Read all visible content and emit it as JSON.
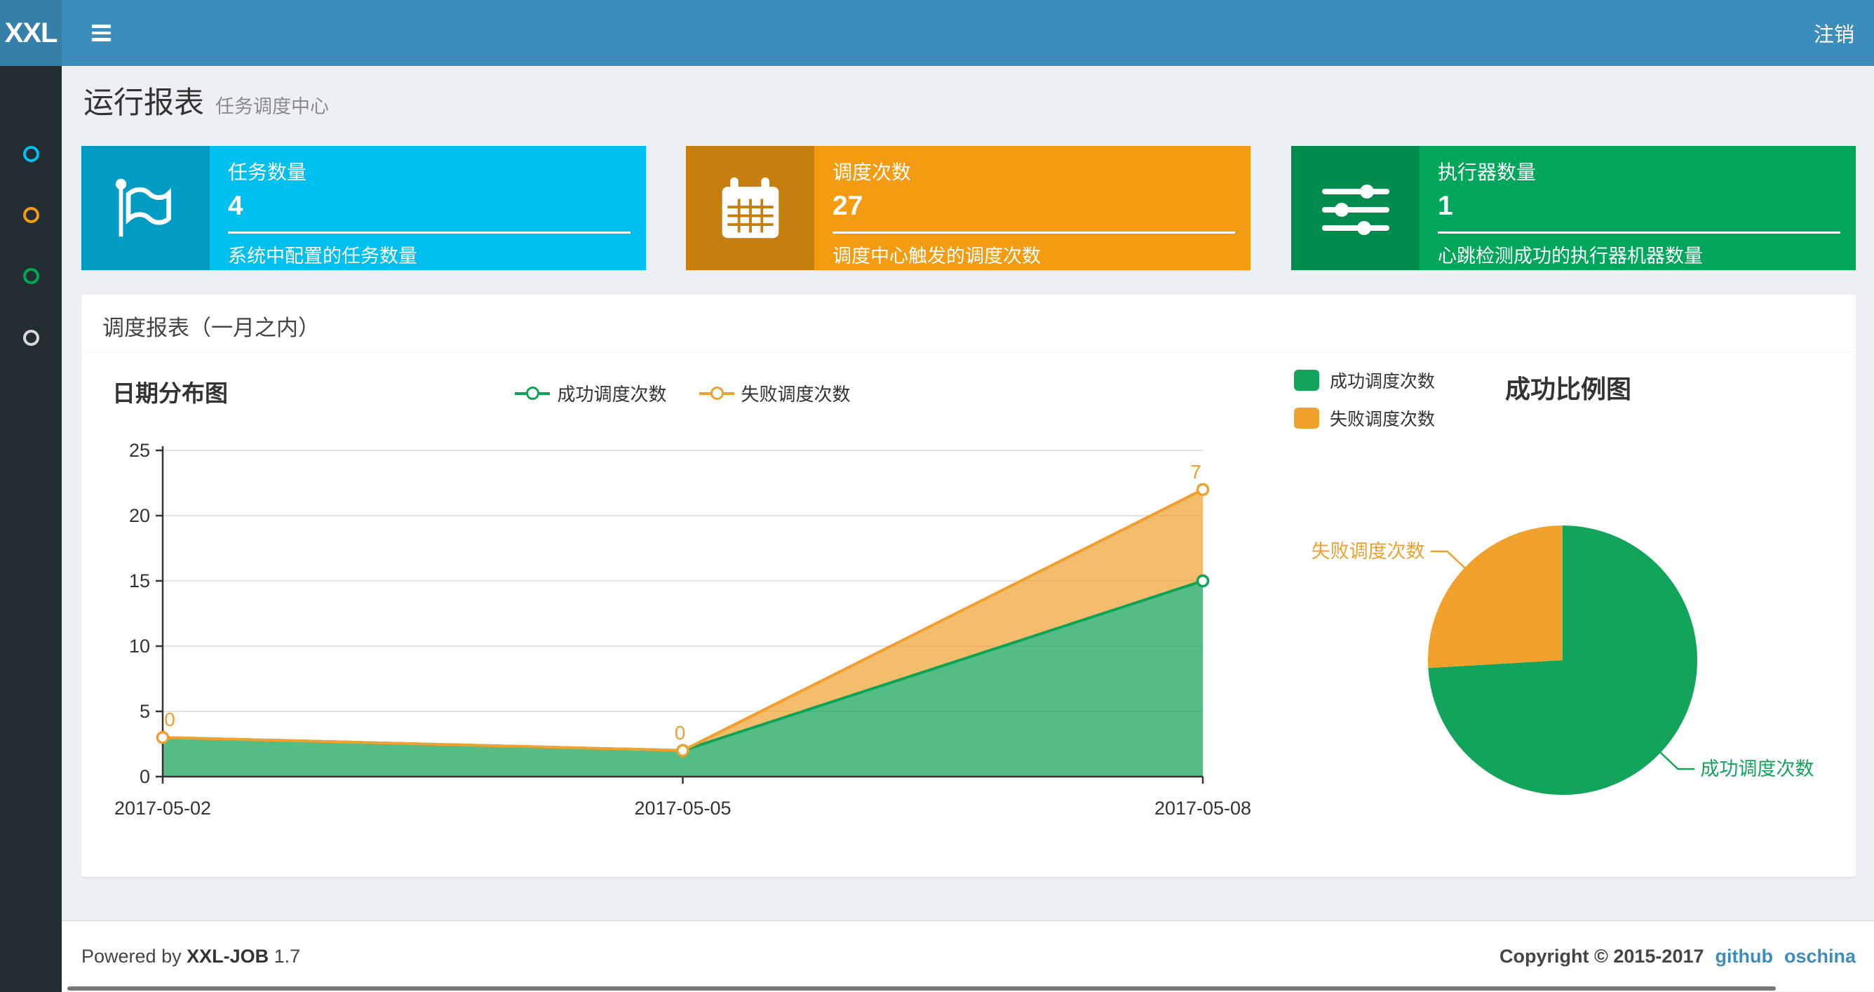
{
  "navbar": {
    "logo": "XXL",
    "logout_label": "注销",
    "bg_color": "#3c8dbc",
    "logo_bg_color": "#367fa9"
  },
  "sidebar": {
    "bg_color": "#222d32",
    "items": [
      {
        "icon": "circle-icon",
        "color": "#00c0ef"
      },
      {
        "icon": "circle-icon",
        "color": "#f39c12"
      },
      {
        "icon": "circle-icon",
        "color": "#00a65a"
      },
      {
        "icon": "circle-icon",
        "color": "#d8d8d8"
      }
    ]
  },
  "header": {
    "title": "运行报表",
    "subtitle": "任务调度中心"
  },
  "info_boxes": [
    {
      "label": "任务数量",
      "value": "4",
      "desc": "系统中配置的任务数量",
      "icon": "flag-icon",
      "color": "#00c0ef",
      "icon_bg": "#009cc3"
    },
    {
      "label": "调度次数",
      "value": "27",
      "desc": "调度中心触发的调度次数",
      "icon": "calendar-icon",
      "color": "#f39c12",
      "icon_bg": "#c67f0e"
    },
    {
      "label": "执行器数量",
      "value": "1",
      "desc": "心跳检测成功的执行器机器数量",
      "icon": "sliders-icon",
      "color": "#00a65a",
      "icon_bg": "#008c4c"
    }
  ],
  "panel": {
    "title": "调度报表（一月之内）"
  },
  "chart_data": [
    {
      "type": "area",
      "title": "日期分布图",
      "stacked": true,
      "x": [
        "2017-05-02",
        "2017-05-05",
        "2017-05-08"
      ],
      "series": [
        {
          "name": "成功调度次数",
          "values": [
            3,
            2,
            15
          ],
          "color": "#0fa358",
          "fill": "rgba(18,163,88,0.72)",
          "labeled": false
        },
        {
          "name": "失败调度次数",
          "values": [
            0,
            0,
            7
          ],
          "color": "#efa02e",
          "fill": "rgba(240,161,46,0.70)",
          "labeled": true
        }
      ],
      "ylim": [
        0,
        25
      ],
      "yticks": [
        0,
        5,
        10,
        15,
        20,
        25
      ],
      "grid": true,
      "grid_color": "#e3e3e3",
      "axis_color": "#333333",
      "legend_position": "top"
    },
    {
      "type": "pie",
      "title": "成功比例图",
      "slices": [
        {
          "name": "成功调度次数",
          "value": 20,
          "color": "#13a45c"
        },
        {
          "name": "失败调度次数",
          "value": 7,
          "color": "#f0a12c"
        }
      ],
      "legend_position": "top-left",
      "start_angle_deg": -90
    }
  ],
  "footer": {
    "powered_prefix": "Powered by",
    "brand": "XXL-JOB",
    "version": "1.7",
    "copyright": "Copyright © 2015-2017",
    "links": [
      {
        "label": "github"
      },
      {
        "label": "oschina"
      }
    ],
    "link_color": "#3c8dbc"
  }
}
